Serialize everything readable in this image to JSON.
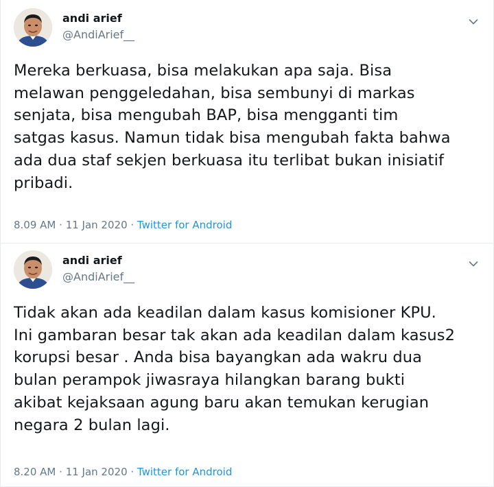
{
  "tweets": [
    {
      "author_name": "andi arief",
      "author_handle": "@AndiArief__",
      "text": "Mereka berkuasa, bisa melakukan apa saja. Bisa\nmelawan penggeledahan, bisa sembunyi di markas\nsenjata, bisa mengubah BAP, bisa mengganti tim\nsatgas kasus. Namun tidak bisa mengubah fakta bahwa\nada dua staf sekjen berkuasa itu terlibat bukan inisiatif\npribadi.",
      "time": "8.09 AM",
      "separator": " · ",
      "date": "11 Jan 2020",
      "source": "Twitter for Android",
      "menu_icon": "chevron-down-icon"
    },
    {
      "author_name": "andi arief",
      "author_handle": "@AndiArief__",
      "text": "Tidak akan ada keadilan dalam kasus komisioner KPU.\nIni gambaran besar tak akan ada keadilan dalam kasus2\nkorupsi besar . Anda bisa bayangkan ada wakru dua\nbulan perampok jiwasraya hilangkan barang bukti\nakibat kejaksaan agung baru akan temukan kerugian\nnegara 2 bulan lagi.",
      "time": "8.20 AM",
      "separator": " · ",
      "date": "11 Jan 2020",
      "source": "Twitter for Android",
      "menu_icon": "chevron-down-icon"
    }
  ],
  "colors": {
    "text_primary": "#14171a",
    "text_secondary": "#657786",
    "link": "#1b95e0",
    "divider": "#e6ecf0"
  }
}
